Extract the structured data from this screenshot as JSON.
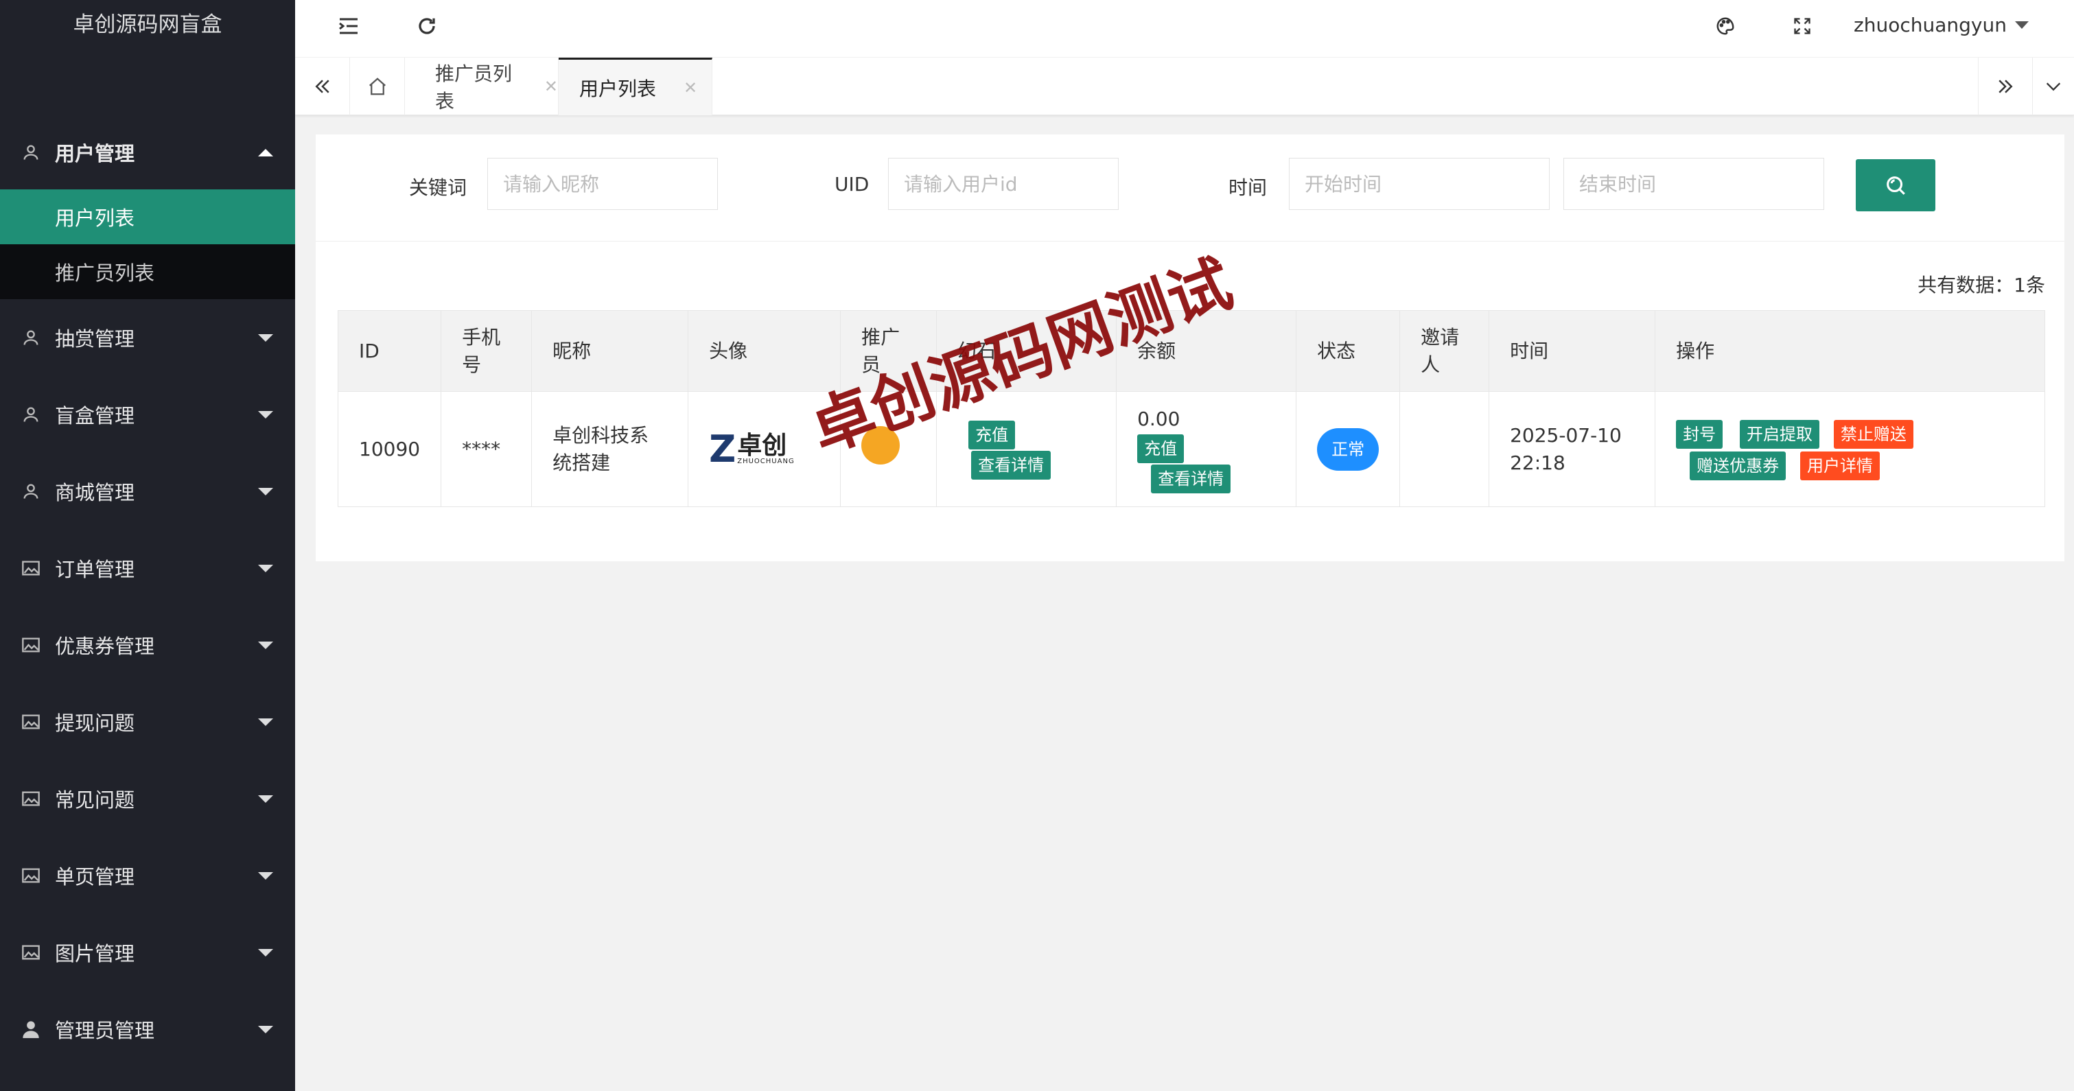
{
  "app": {
    "title": "卓创源码网盲盒"
  },
  "sidebar": {
    "menus": [
      {
        "label": "用户管理",
        "icon": "user-icon",
        "expanded": true,
        "children": [
          {
            "label": "用户列表",
            "active": true
          },
          {
            "label": "推广员列表",
            "active": false
          }
        ]
      },
      {
        "label": "抽赏管理",
        "icon": "user-icon"
      },
      {
        "label": "盲盒管理",
        "icon": "user-icon"
      },
      {
        "label": "商城管理",
        "icon": "user-icon"
      },
      {
        "label": "订单管理",
        "icon": "image-icon"
      },
      {
        "label": "优惠券管理",
        "icon": "image-icon"
      },
      {
        "label": "提现问题",
        "icon": "image-icon"
      },
      {
        "label": "常见问题",
        "icon": "image-icon"
      },
      {
        "label": "单页管理",
        "icon": "image-icon"
      },
      {
        "label": "图片管理",
        "icon": "image-icon"
      },
      {
        "label": "管理员管理",
        "icon": "admin-icon"
      }
    ]
  },
  "header": {
    "username": "zhuochuangyun"
  },
  "tabs": [
    {
      "label": "推广员列表",
      "active": false
    },
    {
      "label": "用户列表",
      "active": true
    }
  ],
  "filters": {
    "keyword_label": "关键词",
    "keyword_placeholder": "请输入昵称",
    "uid_label": "UID",
    "uid_placeholder": "请输入用户id",
    "time_label": "时间",
    "start_placeholder": "开始时间",
    "end_placeholder": "结束时间"
  },
  "summary": {
    "total_text": "共有数据：1条"
  },
  "table": {
    "headers": [
      "ID",
      "手机号",
      "昵称",
      "头像",
      "推广员",
      "幻石",
      "余额",
      "状态",
      "邀请人",
      "时间",
      "操作"
    ],
    "rows": [
      {
        "id": "10090",
        "phone": "****",
        "nickname": "卓创科技系统搭建",
        "avatar_cn": "卓创",
        "avatar_en": "ZHUOCHUANG",
        "promoter": "",
        "stone_value": "",
        "stone_recharge": "充值",
        "stone_detail": "查看详情",
        "balance": "0.00",
        "balance_recharge": "充值",
        "balance_detail": "查看详情",
        "status": "正常",
        "inviter": "",
        "time": "2025-07-10 22:18",
        "actions": {
          "ban": "封号",
          "open_withdraw": "开启提取",
          "forbid_gift": "禁止赠送",
          "give_coupon": "赠送优惠券",
          "user_detail": "用户详情"
        }
      }
    ]
  },
  "watermark": "卓创源码网测试",
  "colors": {
    "sidebar": "#20222a",
    "accent": "#1f8f76",
    "danger": "#ff4c1f",
    "status_blue": "#1e8fff",
    "watermark": "#8b0a0a"
  }
}
